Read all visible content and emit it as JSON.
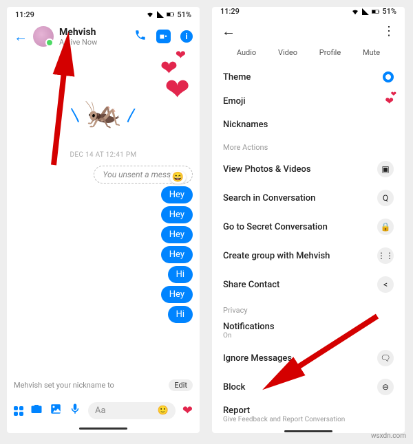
{
  "statusbar": {
    "time": "11:29",
    "battery": "51%"
  },
  "chat": {
    "name": "Mehvish",
    "status": "Active Now",
    "timestamp": "DEC 14 AT 12:41 PM",
    "unsent": "You unsent a message",
    "messages": [
      "Hey",
      "Hey",
      "Hey",
      "Hey",
      "Hi",
      "Hey",
      "Hi"
    ],
    "system_prefix": "Mehvish set your nickname to",
    "system_edit": "Edit",
    "composer_placeholder": "Aa"
  },
  "settings": {
    "tabs": [
      "Audio",
      "Video",
      "Profile",
      "Mute"
    ],
    "rows_top": [
      {
        "label": "Theme"
      },
      {
        "label": "Emoji"
      },
      {
        "label": "Nicknames"
      }
    ],
    "more_actions_title": "More Actions",
    "more_rows": [
      {
        "label": "View Photos & Videos"
      },
      {
        "label": "Search in Conversation"
      },
      {
        "label": "Go to Secret Conversation"
      },
      {
        "label": "Create group with Mehvish"
      },
      {
        "label": "Share Contact"
      }
    ],
    "privacy_title": "Privacy",
    "privacy_rows": [
      {
        "label": "Notifications",
        "sub": "On"
      },
      {
        "label": "Ignore Messages"
      },
      {
        "label": "Block"
      },
      {
        "label": "Report",
        "sub": "Give Feedback and Report Conversation"
      }
    ]
  },
  "watermark": "wsxdn.com"
}
